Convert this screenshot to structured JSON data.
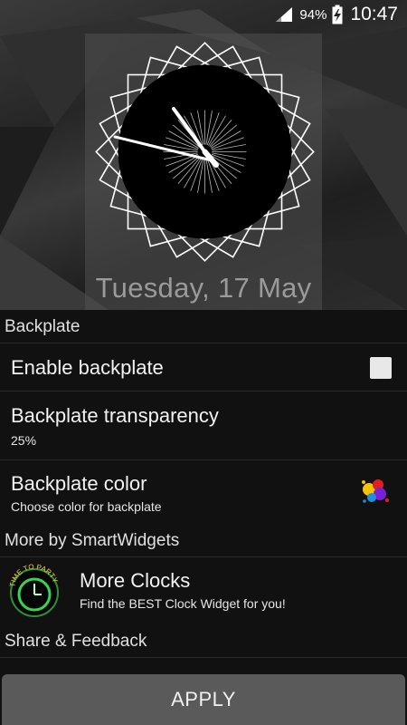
{
  "status": {
    "battery_pct": "94%",
    "time": "10:47",
    "icons": [
      "signal-icon",
      "battery-charging-icon"
    ]
  },
  "preview": {
    "date": "Tuesday, 17 May"
  },
  "backplate_section": {
    "header": "Backplate",
    "enable": {
      "label": "Enable backplate",
      "checked": false
    },
    "transparency": {
      "label": "Backplate transparency",
      "value": "25%"
    },
    "color": {
      "label": "Backplate color",
      "summary": "Choose color for backplate",
      "icon": "paint-splash-icon"
    }
  },
  "more_section": {
    "header": "More by SmartWidgets",
    "more_clocks": {
      "title": "More Clocks",
      "subtitle": "Find the BEST Clock Widget for you!",
      "icon_text": "TIME TO PARTY",
      "icon": "party-clock-icon"
    }
  },
  "share_section": {
    "header": "Share & Feedback"
  },
  "apply_button": "APPLY",
  "colors": {
    "background": "#111111",
    "apply_bg": "#5a5a5a",
    "accent_green": "#39d353"
  }
}
